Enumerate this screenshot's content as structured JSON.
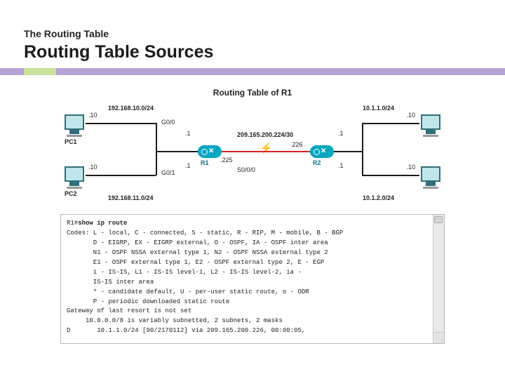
{
  "kicker": "The Routing Table",
  "title": "Routing Table Sources",
  "diagram": {
    "title": "Routing Table of R1",
    "hosts": {
      "pc1": "PC1",
      "pc2": "PC2"
    },
    "host_addrs": {
      "pc1": ".10",
      "pc2": ".10",
      "pc3": ".10",
      "pc4": ".10"
    },
    "networks": {
      "n1": "192.168.10.0/24",
      "n2": "192.168.11.0/24",
      "n3": "10.1.1.0/24",
      "n4": "10.1.2.0/24",
      "wan": "209.165.200.224/30"
    },
    "interfaces": {
      "r1_g00": "G0/0",
      "r1_g01": "G0/1",
      "r1_g00_ip": ".1",
      "r1_g01_ip": ".1",
      "r1_s": "S0/0/0",
      "r1_s_ip": ".225",
      "r2_s_ip": ".226",
      "r2_g00_ip": ".1",
      "r2_g01_ip": ".1"
    },
    "routers": {
      "r1": "R1",
      "r2": "R2"
    }
  },
  "terminal": {
    "prompt": "R1#",
    "command": "show ip route",
    "lines": [
      "Codes: L - local, C - connected, S - static, R - RIP, M - mobile, B - BGP",
      "       D - EIGRP, EX - EIGRP external, O - OSPF, IA - OSPF inter area",
      "       N1 - OSPF NSSA external type 1, N2 - OSPF NSSA external type 2",
      "       E1 - OSPF external type 1, E2 - OSPF external type 2, E - EGP",
      "       i - IS-IS, L1 - IS-IS level-1, L2 - IS-IS level-2, ia -",
      "       IS-IS inter area",
      "       * - candidate default, U - per-user static route, o - ODR",
      "       P - periodic downloaded static route",
      "Gateway of last resort is not set",
      "     10.0.0.0/8 is variably subnetted, 2 subnets, 2 masks",
      "D       10.1.1.0/24 [90/2170112] via 209.165.200.226, 00:00:05,"
    ]
  }
}
